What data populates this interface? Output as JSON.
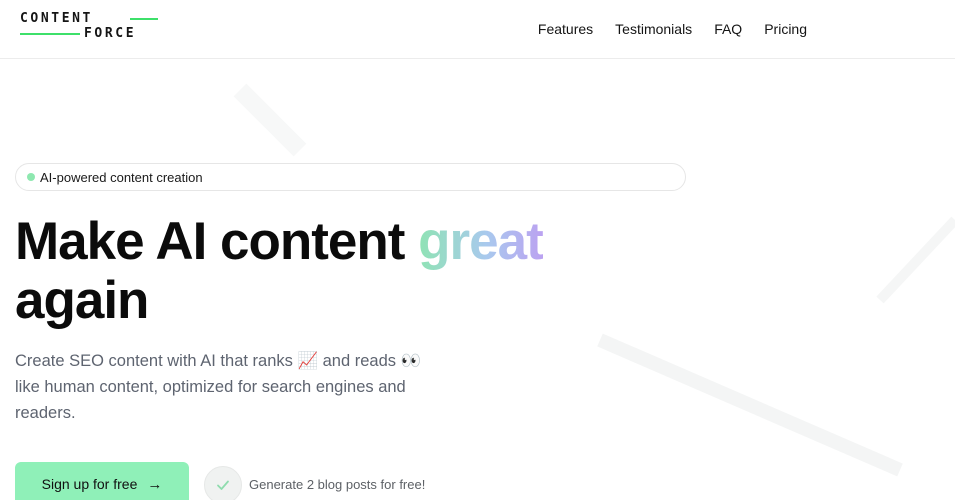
{
  "brand": {
    "line1": "CONTENT",
    "line2": "FORCE",
    "accent": "#3ee06a"
  },
  "nav": {
    "items": [
      "Features",
      "Testimonials",
      "FAQ",
      "Pricing"
    ]
  },
  "hero": {
    "badge": "AI-powered content creation",
    "headline_part1": "Make AI content ",
    "headline_accent": "great",
    "headline_part2": "again",
    "subtext": "Create SEO content with AI that ranks 📈 and reads 👀 like human content, optimized for search engines and readers.",
    "cta_label": "Sign up for free",
    "cta_arrow": "→",
    "note": "Generate 2 blog posts for free!",
    "check_icon": "check-icon"
  },
  "colors": {
    "cta_bg": "#8ff0b8",
    "gradient": [
      "#8fe3b4",
      "#a9c9ee",
      "#bba2f1"
    ],
    "badge_dot": "#8ee8b0"
  }
}
